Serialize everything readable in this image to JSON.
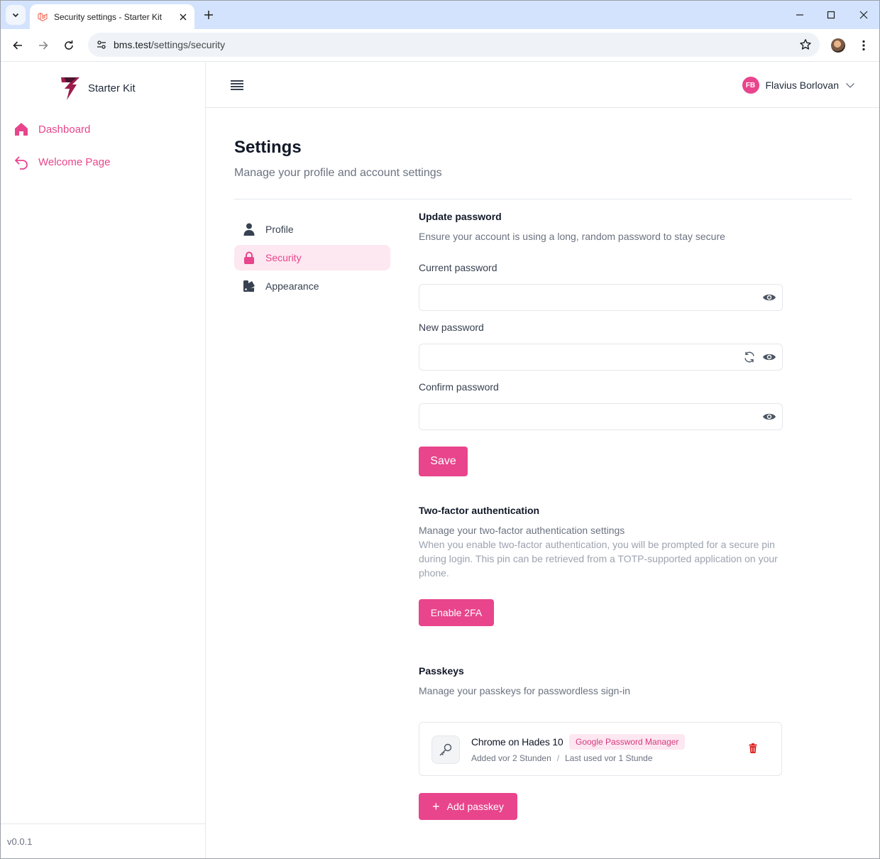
{
  "browser": {
    "tab_title": "Security settings - Starter Kit",
    "url_host": "bms.test",
    "url_path": "/settings/security"
  },
  "sidebar": {
    "brand_name": "Starter Kit",
    "items": [
      {
        "label": "Dashboard",
        "icon": "home-icon"
      },
      {
        "label": "Welcome Page",
        "icon": "back-arrow-icon"
      }
    ],
    "version": "v0.0.1"
  },
  "topbar": {
    "user_initials": "FB",
    "user_name": "Flavius Borlovan"
  },
  "page": {
    "title": "Settings",
    "subtitle": "Manage your profile and account settings"
  },
  "settings_nav": [
    {
      "label": "Profile",
      "icon": "user-icon",
      "active": false
    },
    {
      "label": "Security",
      "icon": "lock-icon",
      "active": true
    },
    {
      "label": "Appearance",
      "icon": "palette-icon",
      "active": false
    }
  ],
  "password": {
    "title": "Update password",
    "description": "Ensure your account is using a long, random password to stay secure",
    "current_label": "Current password",
    "current_value": "",
    "new_label": "New password",
    "new_value": "",
    "confirm_label": "Confirm password",
    "confirm_value": "",
    "save_label": "Save"
  },
  "two_factor": {
    "title": "Two-factor authentication",
    "description": "Manage your two-factor authentication settings",
    "info": "When you enable two-factor authentication, you will be prompted for a secure pin during login. This pin can be retrieved from a TOTP-supported application on your phone.",
    "enable_label": "Enable 2FA"
  },
  "passkeys": {
    "title": "Passkeys",
    "description": "Manage your passkeys for passwordless sign-in",
    "items": [
      {
        "name": "Chrome on Hades 10",
        "provider": "Google Password Manager",
        "added": "Added vor 2 Stunden",
        "separator": "/",
        "last_used": "Last used vor 1 Stunde"
      }
    ],
    "add_label": "Add passkey",
    "add_icon": "+"
  },
  "colors": {
    "accent": "#e8458c",
    "accent_soft": "#fde7f1",
    "danger": "#dc2626"
  }
}
